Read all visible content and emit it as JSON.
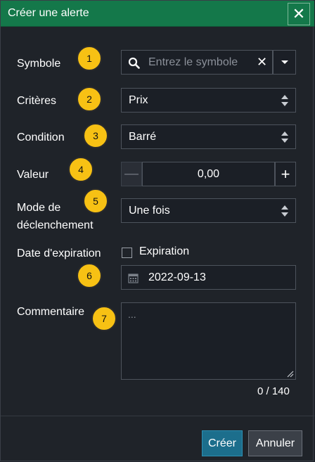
{
  "dialog": {
    "title": "Créer une alerte",
    "close_icon": "close-icon",
    "accent": "#14784a"
  },
  "form": {
    "symbol": {
      "label": "Symbole",
      "placeholder": "Entrez le symbole",
      "clear": "✕"
    },
    "criteria": {
      "label": "Critères",
      "value": "Prix"
    },
    "condition": {
      "label": "Condition",
      "value": "Barré"
    },
    "value": {
      "label": "Valeur",
      "value": "0,00",
      "minus": "—",
      "plus": "+"
    },
    "trigger_mode": {
      "label_line1": "Mode de",
      "label_line2": "déclenchement",
      "value": "Une fois"
    },
    "expiration": {
      "label": "Date d'expiration",
      "checkbox_label": "Expiration",
      "checked": false,
      "date": "2022-09-13"
    },
    "comment": {
      "label": "Commentaire",
      "placeholder": "...",
      "counter": "0 / 140"
    }
  },
  "badges": [
    "1",
    "2",
    "3",
    "4",
    "5",
    "6",
    "7"
  ],
  "footer": {
    "create_label": "Créer",
    "cancel_label": "Annuler"
  }
}
